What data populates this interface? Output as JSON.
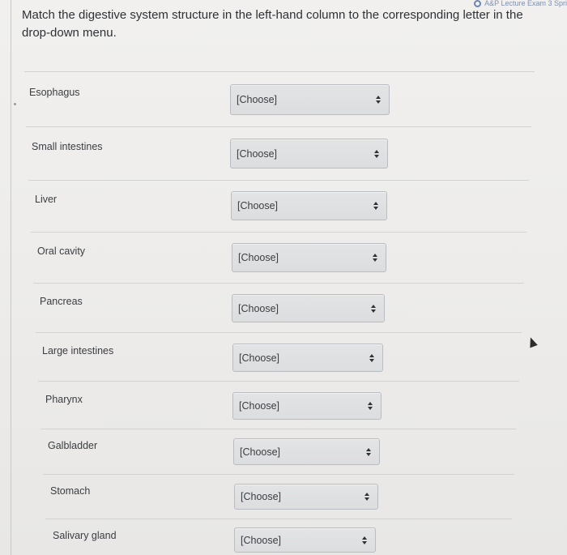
{
  "header": {
    "corner_text": "A&P Lecture Exam 3 Spri",
    "question": "Match the digestive system structure in the left-hand column to the corresponding letter in the drop-down menu."
  },
  "colors": {
    "background": "#ecebe9",
    "select_fill": "#dfe0e2",
    "select_border": "#b9bcc0",
    "text": "#2e3236"
  },
  "rows": [
    {
      "term": "Esophagus",
      "select_value": "[Choose]"
    },
    {
      "term": "Small intestines",
      "select_value": "[Choose]"
    },
    {
      "term": "Liver",
      "select_value": "[Choose]"
    },
    {
      "term": "Oral cavity",
      "select_value": "[Choose]"
    },
    {
      "term": "Pancreas",
      "select_value": "[Choose]"
    },
    {
      "term": "Large intestines",
      "select_value": "[Choose]"
    },
    {
      "term": "Pharynx",
      "select_value": "[Choose]"
    },
    {
      "term": "Galbladder",
      "select_value": "[Choose]"
    },
    {
      "term": "Stomach",
      "select_value": "[Choose]"
    },
    {
      "term": "Salivary gland",
      "select_value": "[Choose]"
    }
  ]
}
